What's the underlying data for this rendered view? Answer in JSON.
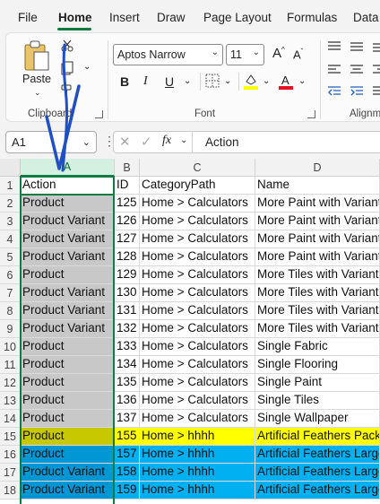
{
  "menu": {
    "tabs": [
      {
        "label": "File"
      },
      {
        "label": "Home",
        "active": true
      },
      {
        "label": "Insert"
      },
      {
        "label": "Draw"
      },
      {
        "label": "Page Layout"
      },
      {
        "label": "Formulas"
      },
      {
        "label": "Data"
      }
    ]
  },
  "ribbon": {
    "clipboard": {
      "paste_label": "Paste",
      "group_label": "Clipboard"
    },
    "font": {
      "font_name": "Aptos Narrow",
      "font_size": "11",
      "bold_label": "B",
      "italic_label": "I",
      "underline_label": "U",
      "group_label": "Font",
      "highlight_color": "#ffff00",
      "font_color": "#e81123"
    },
    "alignment": {
      "group_label": "Alignm"
    }
  },
  "formula_bar": {
    "name_box": "A1",
    "fx_label": "fx",
    "content": "Action"
  },
  "sheet": {
    "columns": [
      "A",
      "B",
      "C",
      "D"
    ],
    "selected_column": "A",
    "rows": [
      {
        "num": "1",
        "a": "Action",
        "b": "ID",
        "c": "CategoryPath",
        "d": "Name",
        "fill": "none"
      },
      {
        "num": "2",
        "a": "Product",
        "b": "125",
        "c": "Home > Calculators",
        "d": "More Paint with Variant",
        "fill": "none"
      },
      {
        "num": "3",
        "a": "Product Variant",
        "b": "126",
        "c": "Home > Calculators",
        "d": "More Paint with Variant",
        "fill": "none"
      },
      {
        "num": "4",
        "a": "Product Variant",
        "b": "127",
        "c": "Home > Calculators",
        "d": "More Paint with Variant",
        "fill": "none"
      },
      {
        "num": "5",
        "a": "Product Variant",
        "b": "128",
        "c": "Home > Calculators",
        "d": "More Paint with Variant",
        "fill": "none"
      },
      {
        "num": "6",
        "a": "Product",
        "b": "129",
        "c": "Home > Calculators",
        "d": "More Tiles with Variant",
        "fill": "none"
      },
      {
        "num": "7",
        "a": "Product Variant",
        "b": "130",
        "c": "Home > Calculators",
        "d": "More Tiles with Variant",
        "fill": "none"
      },
      {
        "num": "8",
        "a": "Product Variant",
        "b": "131",
        "c": "Home > Calculators",
        "d": "More Tiles with Variant",
        "fill": "none"
      },
      {
        "num": "9",
        "a": "Product Variant",
        "b": "132",
        "c": "Home > Calculators",
        "d": "More Tiles with Variant",
        "fill": "none"
      },
      {
        "num": "10",
        "a": "Product",
        "b": "133",
        "c": "Home > Calculators",
        "d": "Single Fabric",
        "fill": "none"
      },
      {
        "num": "11",
        "a": "Product",
        "b": "134",
        "c": "Home > Calculators",
        "d": "Single Flooring",
        "fill": "none"
      },
      {
        "num": "12",
        "a": "Product",
        "b": "135",
        "c": "Home > Calculators",
        "d": "Single Paint",
        "fill": "none"
      },
      {
        "num": "13",
        "a": "Product",
        "b": "136",
        "c": "Home > Calculators",
        "d": "Single Tiles",
        "fill": "none"
      },
      {
        "num": "14",
        "a": "Product",
        "b": "137",
        "c": "Home > Calculators",
        "d": "Single Wallpaper",
        "fill": "none"
      },
      {
        "num": "15",
        "a": "Product",
        "b": "155",
        "c": "Home > hhhh",
        "d": "Artificial Feathers Pack",
        "fill": "yellow"
      },
      {
        "num": "16",
        "a": "Product",
        "b": "157",
        "c": "Home > hhhh",
        "d": "Artificial Feathers Large",
        "fill": "blue"
      },
      {
        "num": "17",
        "a": "Product Variant",
        "b": "158",
        "c": "Home > hhhh",
        "d": "Artificial Feathers Large",
        "fill": "blue"
      },
      {
        "num": "18",
        "a": "Product Variant",
        "b": "159",
        "c": "Home > hhhh",
        "d": "Artificial Feathers Large",
        "fill": "blue"
      }
    ]
  },
  "colors": {
    "accent_green": "#107c41",
    "fill_yellow": "#ffff00",
    "fill_blue": "#00b0f0",
    "annotation_pen": "#1f4fc4"
  }
}
